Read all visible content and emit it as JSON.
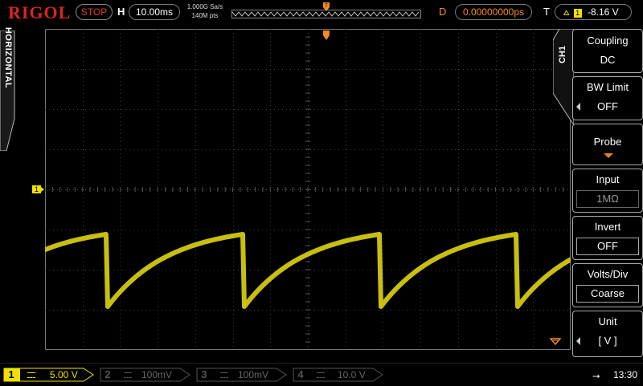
{
  "brand": "RIGOL",
  "topbar": {
    "run_state": "STOP",
    "h_label": "H",
    "timebase": "10.00ms",
    "sample_rate": "1.000G Sa/s",
    "memory_depth": "140M pts",
    "d_label": "D",
    "delay": "0.00000000ps",
    "t_label": "T",
    "trigger_source": "1",
    "trigger_level": "-8.16 V"
  },
  "left_tab": "HORIZONTAL",
  "channel_marker": "1",
  "right_menu": {
    "tab_label": "CH1",
    "coupling": {
      "title": "Coupling",
      "value": "DC"
    },
    "bw_limit": {
      "title": "BW Limit",
      "value": "OFF"
    },
    "probe": {
      "title": "Probe"
    },
    "input": {
      "title": "Input",
      "value": "1MΩ"
    },
    "invert": {
      "title": "Invert",
      "value": "OFF"
    },
    "volts_div": {
      "title": "Volts/Div",
      "value": "Coarse"
    },
    "unit": {
      "title": "Unit",
      "value": "[ V ]"
    }
  },
  "bottombar": {
    "channels": [
      {
        "num": "1",
        "value": "5.00 V",
        "active": true
      },
      {
        "num": "2",
        "value": "100mV",
        "active": false
      },
      {
        "num": "3",
        "value": "100mV",
        "active": false
      },
      {
        "num": "4",
        "value": "10.0 V",
        "active": false
      }
    ],
    "time": "13:30"
  },
  "colors": {
    "ch1": "#f0e000",
    "trace": "#c8bf10",
    "accent_orange": "#f28b22",
    "logo_red": "#d8261f",
    "stop_red": "#e03a2b"
  },
  "icons": {
    "trigger": "rising-edge-icon",
    "usb": "usb-icon"
  }
}
